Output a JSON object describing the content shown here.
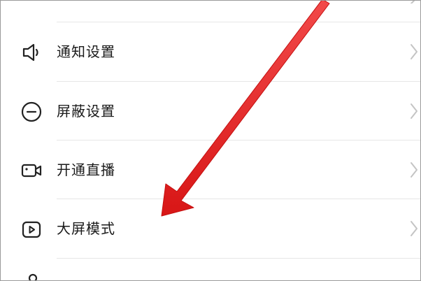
{
  "settings_menu": {
    "items": [
      {
        "label": "通知设置",
        "icon": "speaker-icon"
      },
      {
        "label": "屏蔽设置",
        "icon": "block-minus-icon"
      },
      {
        "label": "开通直播",
        "icon": "video-camera-icon"
      },
      {
        "label": "大屏模式",
        "icon": "play-screen-icon"
      }
    ]
  },
  "annotation": {
    "color": "#e01e1e"
  }
}
